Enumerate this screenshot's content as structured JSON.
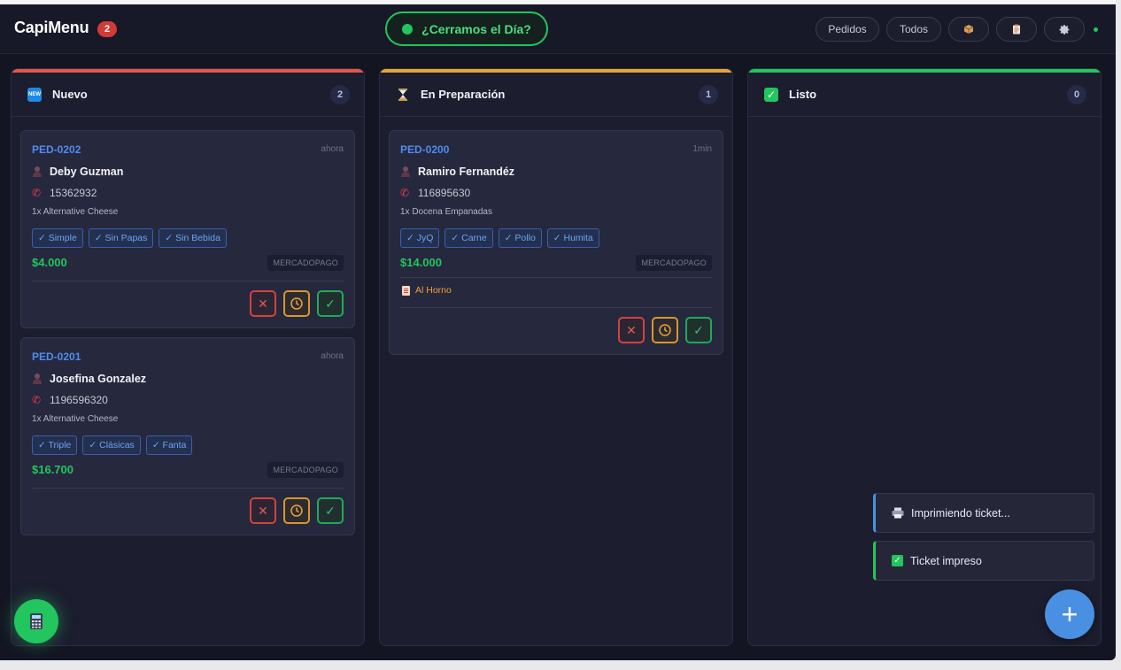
{
  "header": {
    "brand": "CapiMenu",
    "brand_badge": "2",
    "close_day_label": "¿Cerramos el Día?",
    "nav": {
      "pedidos": "Pedidos",
      "todos": "Todos"
    },
    "icons": [
      "package-icon",
      "clipboard-icon",
      "gear-icon"
    ]
  },
  "columns": [
    {
      "title": "Nuevo",
      "count": "2",
      "color": "#e2544d",
      "orders": [
        {
          "id": "PED-0202",
          "time": "ahora",
          "customer": "Deby Guzman",
          "phone": "15362932",
          "item": "1x Alternative Cheese",
          "tags": [
            "✓ Simple",
            "✓ Sin Papas",
            "✓ Sin Bebida"
          ],
          "price": "$4.000",
          "payment": "MERCADOPAGO"
        },
        {
          "id": "PED-0201",
          "time": "ahora",
          "customer": "Josefina Gonzalez",
          "phone": "1196596320",
          "item": "1x Alternative Cheese",
          "tags": [
            "✓ Triple",
            "✓ Clásicas",
            "✓ Fanta"
          ],
          "price": "$16.700",
          "payment": "MERCADOPAGO"
        }
      ]
    },
    {
      "title": "En Preparación",
      "count": "1",
      "color": "#e8a43a",
      "orders": [
        {
          "id": "PED-0200",
          "time": "1min",
          "customer": "Ramiro Fernandéz",
          "phone": "116895630",
          "item": "1x Docena Empanadas",
          "tags": [
            "✓ JyQ",
            "✓ Carne",
            "✓ Pollo",
            "✓ Humita"
          ],
          "price": "$14.000",
          "payment": "MERCADOPAGO",
          "note": "Al Horno"
        }
      ]
    },
    {
      "title": "Listo",
      "count": "0",
      "color": "#22c55e",
      "orders": []
    }
  ],
  "toasts": [
    {
      "text": "Imprimiendo ticket...",
      "color": "#4a90e2"
    },
    {
      "text": "Ticket impreso",
      "color": "#22c55e"
    }
  ],
  "fab_add_label": "+"
}
